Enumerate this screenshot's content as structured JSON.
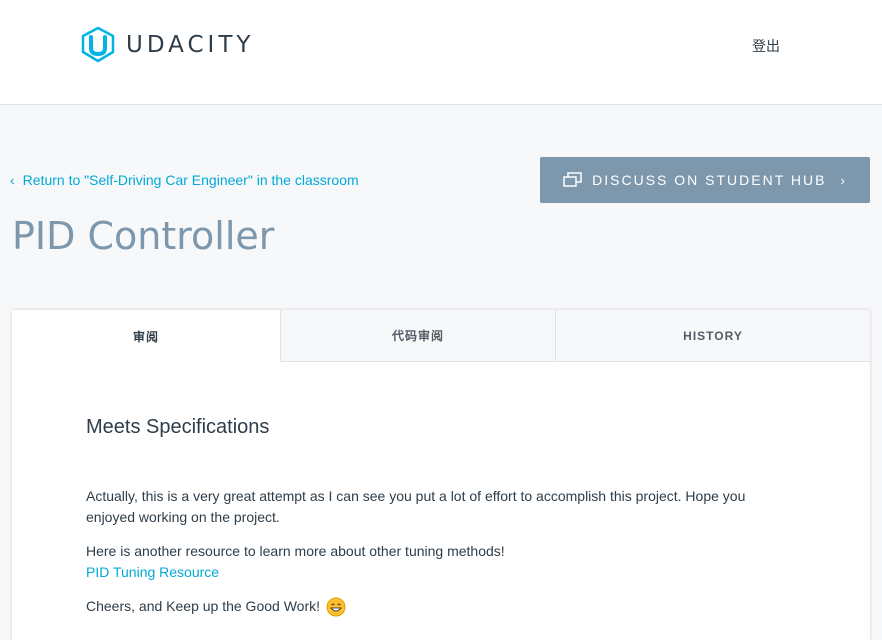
{
  "header": {
    "brand": "UDACITY",
    "logout_label": "登出"
  },
  "nav": {
    "back_label": "Return to \"Self-Driving Car Engineer\" in the classroom",
    "discuss_label": "DISCUSS ON STUDENT HUB"
  },
  "page": {
    "title": "PID Controller"
  },
  "tabs": [
    {
      "label": "审阅"
    },
    {
      "label": "代码审阅"
    },
    {
      "label": "HISTORY"
    }
  ],
  "review": {
    "status": "Meets Specifications",
    "paragraph1": "Actually, this is a very great attempt as I can see you put a lot of effort to accomplish this project. Hope you enjoyed working on the project.",
    "paragraph2": "Here is another resource to learn more about other tuning methods!",
    "link_label": "PID Tuning Resource",
    "paragraph3": "Cheers, and Keep up the Good Work!"
  },
  "colors": {
    "accent": "#02a9d8",
    "button": "#7d97ad",
    "title": "#7d97ad",
    "text": "#2e3d49"
  },
  "icons": [
    "udacity-logo",
    "chevron-left-icon",
    "chat-bubbles-icon",
    "chevron-right-icon",
    "grin-emoji-icon"
  ]
}
